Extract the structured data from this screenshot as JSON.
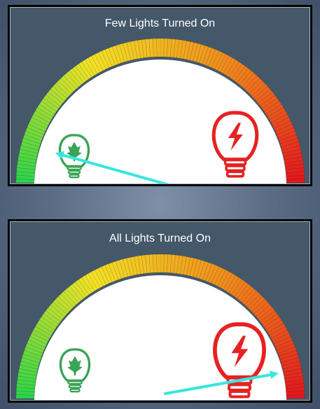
{
  "colors": {
    "green": "#2bd44a",
    "yellow": "#f3e226",
    "orange": "#f08a1c",
    "red": "#e3161d",
    "needle": "#38e6dd",
    "eco_bulb": "#3aa355",
    "hot_bulb": "#e52222"
  },
  "panels": [
    {
      "title": "Few Lights Turned On",
      "needle_level": 0.15,
      "eco_icon": "leaf-lightbulb-icon",
      "hot_icon": "lightning-lightbulb-icon"
    },
    {
      "title": "All Lights Turned On",
      "needle_level": 0.9,
      "eco_icon": "leaf-lightbulb-icon",
      "hot_icon": "lightning-lightbulb-icon"
    }
  ]
}
